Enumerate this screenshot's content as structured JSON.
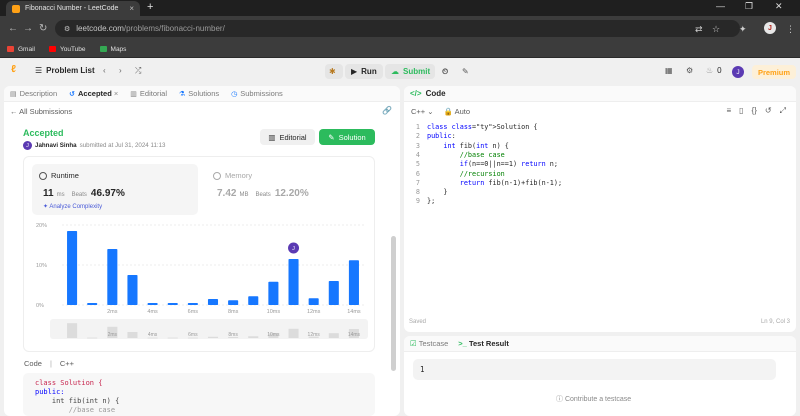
{
  "browser": {
    "tab_title": "Fibonacci Number - LeetCode",
    "tab_close": "×",
    "new_tab": "+",
    "win_min": "—",
    "win_max": "❐",
    "win_close": "✕",
    "url_host": "leetcode.com",
    "url_path": "/problems/fibonacci-number/",
    "bookmarks": [
      "Gmail",
      "YouTube",
      "Maps"
    ],
    "profile_initial": "J"
  },
  "lc_nav": {
    "problem_list": "Problem List",
    "run": "Run",
    "submit": "Submit",
    "streak": "0",
    "avatar_initial": "J",
    "premium": "Premium"
  },
  "left_tabs": {
    "description": "Description",
    "accepted": "Accepted",
    "accepted_close": "×",
    "editorial": "Editorial",
    "solutions": "Solutions",
    "submissions": "Submissions"
  },
  "submission": {
    "back_label": "All Submissions",
    "status": "Accepted",
    "user": "Jahnavi Sinha",
    "submitted_text": "submitted at Jul 31, 2024 11:13",
    "editorial_btn": "Editorial",
    "solution_btn": "Solution"
  },
  "runtime": {
    "title": "Runtime",
    "value": "11",
    "unit": "ms",
    "beats_label": "Beats",
    "beats": "46.97%",
    "analyze": "Analyze Complexity"
  },
  "memory": {
    "title": "Memory",
    "value": "7.42",
    "unit": "MB",
    "beats_label": "Beats",
    "beats": "12.20%"
  },
  "chart_data": {
    "type": "bar",
    "y_ticks": [
      "20%",
      "10%",
      "0%"
    ],
    "ylim": [
      0,
      20
    ],
    "x_tick_labels": [
      "2ms",
      "4ms",
      "6ms",
      "8ms",
      "10ms",
      "12ms",
      "14ms"
    ],
    "overview_labels": [
      "2ms",
      "4ms",
      "6ms",
      "8ms",
      "10ms",
      "12ms",
      "14ms"
    ],
    "values": [
      18.5,
      0.5,
      14,
      7.5,
      0.5,
      0.5,
      0.5,
      1.5,
      1.2,
      2.2,
      5.8,
      11.5,
      1.7,
      6,
      11.2
    ],
    "highlight_index": 11,
    "marker_initial": "J",
    "color": "#1677ff"
  },
  "code_preview": {
    "label": "Code",
    "lang": "C++",
    "lines": [
      "class Solution {",
      "public:",
      "    int fib(int n) {",
      "        //base case"
    ]
  },
  "editor": {
    "title": "Code",
    "lang": "C++",
    "mode": "Auto",
    "saved": "Saved",
    "cursor": "Ln 9, Col 3",
    "lines": [
      "class Solution {",
      "public:",
      "    int fib(int n) {",
      "        //base case",
      "        if(n==0||n==1) return n;",
      "        //recursion",
      "        return fib(n-1)+fib(n-1);",
      "    }",
      "};"
    ]
  },
  "test": {
    "tab_testcase": "Testcase",
    "tab_result": "Test Result",
    "value": "1",
    "contribute": "Contribute a testcase"
  }
}
